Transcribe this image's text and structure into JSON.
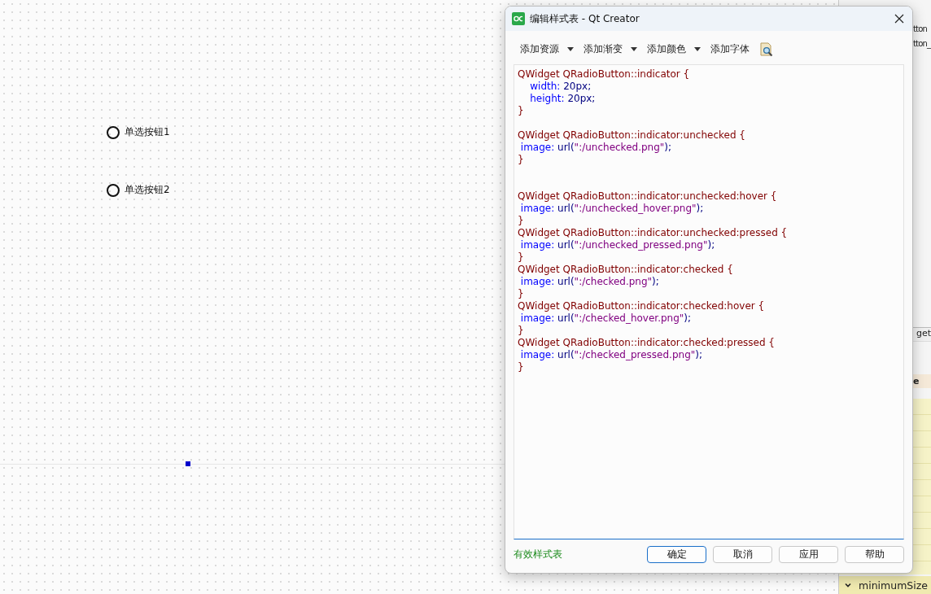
{
  "form": {
    "radio_buttons": [
      {
        "label": "单选按钮1",
        "checked": false
      },
      {
        "label": "单选按钮2",
        "checked": false
      }
    ]
  },
  "side_panel": {
    "items": [
      {
        "text": "tton",
        "kind": "object"
      },
      {
        "text": "tton_",
        "kind": "object"
      },
      {
        "text": "get",
        "kind": "class"
      },
      {
        "text": "e",
        "kind": "header"
      },
      {
        "text": "minimumSize",
        "kind": "property",
        "expanded": true
      }
    ]
  },
  "dialog": {
    "title": "编辑样式表 - Qt Creator",
    "toolbar": [
      {
        "label": "添加资源",
        "dropdown": true
      },
      {
        "label": "添加渐变",
        "dropdown": true
      },
      {
        "label": "添加颜色",
        "dropdown": true
      },
      {
        "label": "添加字体",
        "dropdown": false
      }
    ],
    "code_lines": [
      {
        "segments": [
          {
            "kind": "selector",
            "text": "QWidget QRadioButton::indicator {"
          }
        ]
      },
      {
        "segments": [
          {
            "kind": "property",
            "text": "    width:"
          },
          {
            "kind": "value",
            "text": " 20px;"
          }
        ]
      },
      {
        "segments": [
          {
            "kind": "property",
            "text": "    height:"
          },
          {
            "kind": "value",
            "text": " 20px;"
          }
        ]
      },
      {
        "segments": [
          {
            "kind": "selector",
            "text": "}"
          }
        ]
      },
      {
        "kind": "blank"
      },
      {
        "segments": [
          {
            "kind": "selector",
            "text": "QWidget QRadioButton::indicator:unchecked {"
          }
        ]
      },
      {
        "segments": [
          {
            "kind": "property",
            "text": " image:"
          },
          {
            "kind": "value",
            "text": " url("
          },
          {
            "kind": "string",
            "text": "\":/unchecked.png\""
          },
          {
            "kind": "value",
            "text": ");"
          }
        ]
      },
      {
        "segments": [
          {
            "kind": "selector",
            "text": "}"
          }
        ]
      },
      {
        "kind": "blank"
      },
      {
        "kind": "blank"
      },
      {
        "segments": [
          {
            "kind": "selector",
            "text": "QWidget QRadioButton::indicator:unchecked:hover {"
          }
        ]
      },
      {
        "segments": [
          {
            "kind": "property",
            "text": " image:"
          },
          {
            "kind": "value",
            "text": " url("
          },
          {
            "kind": "string",
            "text": "\":/unchecked_hover.png\""
          },
          {
            "kind": "value",
            "text": ");"
          }
        ]
      },
      {
        "segments": [
          {
            "kind": "selector",
            "text": "}"
          }
        ]
      },
      {
        "segments": [
          {
            "kind": "selector",
            "text": "QWidget QRadioButton::indicator:unchecked:pressed {"
          }
        ]
      },
      {
        "segments": [
          {
            "kind": "property",
            "text": " image:"
          },
          {
            "kind": "value",
            "text": " url("
          },
          {
            "kind": "string",
            "text": "\":/unchecked_pressed.png\""
          },
          {
            "kind": "value",
            "text": ");"
          }
        ]
      },
      {
        "segments": [
          {
            "kind": "selector",
            "text": "}"
          }
        ]
      },
      {
        "segments": [
          {
            "kind": "selector",
            "text": "QWidget QRadioButton::indicator:checked {"
          }
        ]
      },
      {
        "segments": [
          {
            "kind": "property",
            "text": " image:"
          },
          {
            "kind": "value",
            "text": " url("
          },
          {
            "kind": "string",
            "text": "\":/checked.png\""
          },
          {
            "kind": "value",
            "text": ");"
          }
        ]
      },
      {
        "segments": [
          {
            "kind": "selector",
            "text": "}"
          }
        ]
      },
      {
        "segments": [
          {
            "kind": "selector",
            "text": "QWidget QRadioButton::indicator:checked:hover {"
          }
        ]
      },
      {
        "segments": [
          {
            "kind": "property",
            "text": " image:"
          },
          {
            "kind": "value",
            "text": " url("
          },
          {
            "kind": "string",
            "text": "\":/checked_hover.png\""
          },
          {
            "kind": "value",
            "text": ");"
          }
        ]
      },
      {
        "segments": [
          {
            "kind": "selector",
            "text": "}"
          }
        ]
      },
      {
        "segments": [
          {
            "kind": "selector",
            "text": "QWidget QRadioButton::indicator:checked:pressed {"
          }
        ]
      },
      {
        "segments": [
          {
            "kind": "property",
            "text": " image:"
          },
          {
            "kind": "value",
            "text": " url("
          },
          {
            "kind": "string",
            "text": "\":/checked_pressed.png\""
          },
          {
            "kind": "value",
            "text": ");"
          }
        ]
      },
      {
        "segments": [
          {
            "kind": "selector",
            "text": "}"
          }
        ]
      }
    ],
    "status": "有效样式表",
    "buttons": [
      {
        "label": "确定",
        "default": true
      },
      {
        "label": "取消",
        "default": false
      },
      {
        "label": "应用",
        "default": false
      },
      {
        "label": "帮助",
        "default": false
      }
    ]
  }
}
